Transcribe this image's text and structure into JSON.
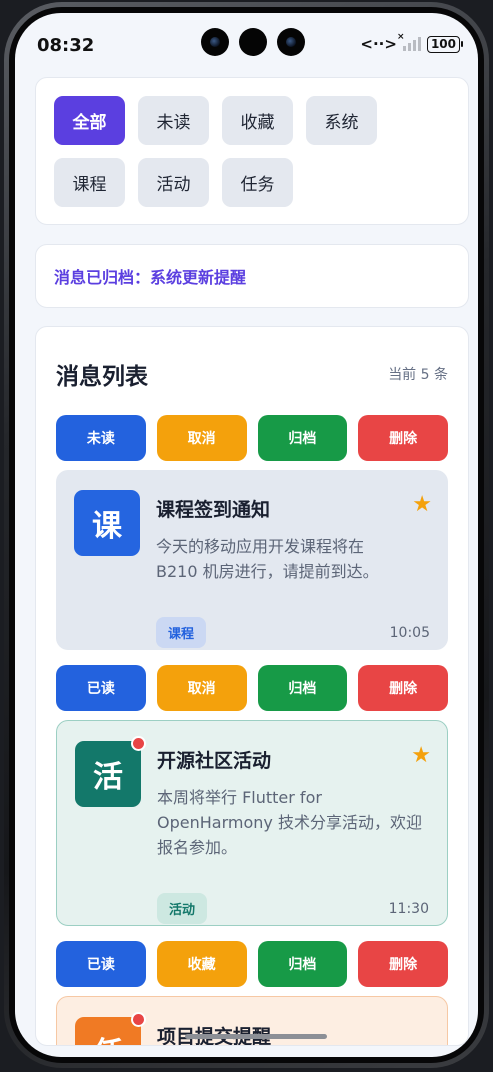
{
  "status_bar": {
    "time": "08:32",
    "battery": "100"
  },
  "filters": [
    [
      "全部",
      "未读",
      "收藏",
      "系统"
    ],
    [
      "课程",
      "活动",
      "任务"
    ]
  ],
  "archive_notice": "消息已归档：系统更新提醒",
  "list": {
    "title": "消息列表",
    "count": "当前 5 条",
    "items": [
      {
        "avatar_char": "课",
        "title": "课程签到通知",
        "text": "今天的移动应用开发课程将在 B210 机房进行，请提前到达。",
        "tag": "课程",
        "time": "10:05",
        "actions": [
          "未读",
          "取消",
          "归档",
          "删除"
        ]
      },
      {
        "avatar_char": "活",
        "title": "开源社区活动",
        "text": "本周将举行 Flutter for OpenHarmony 技术分享活动，欢迎报名参加。",
        "tag": "活动",
        "time": "11:30",
        "actions": [
          "已读",
          "取消",
          "归档",
          "删除"
        ]
      },
      {
        "avatar_char": "任",
        "title": "项目提交提醒",
        "actions": [
          "已读",
          "收藏",
          "归档",
          "删除"
        ]
      }
    ]
  },
  "colors": {
    "accent": "#5b3fe0",
    "blue": "#2362de",
    "orange": "#f4a10c",
    "green": "#179a47",
    "red": "#e84545"
  }
}
